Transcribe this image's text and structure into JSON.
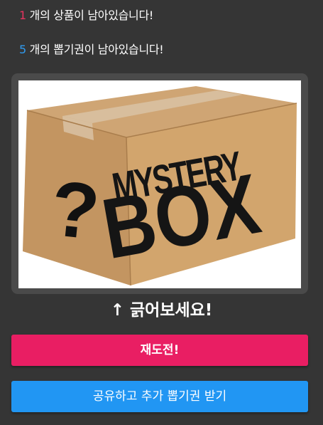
{
  "status": {
    "products_count": "1",
    "products_text": " 개의 상품이 남아있습니다!",
    "tickets_count": "5",
    "tickets_text": " 개의 뽑기권이 남아있습니다!"
  },
  "prize_image": {
    "line1": "MYSTERY",
    "line2": "BOX",
    "symbol": "?"
  },
  "hint": {
    "arrow": "↑",
    "text": " 긁어보세요!"
  },
  "buttons": {
    "retry_label": "재도전!",
    "share_label": "공유하고 추가 뽑기권 받기"
  },
  "colors": {
    "background": "#353535",
    "retry": "#e91e63",
    "share": "#2196f3",
    "count_products": "#e8345f",
    "count_tickets": "#2f9bf0"
  }
}
